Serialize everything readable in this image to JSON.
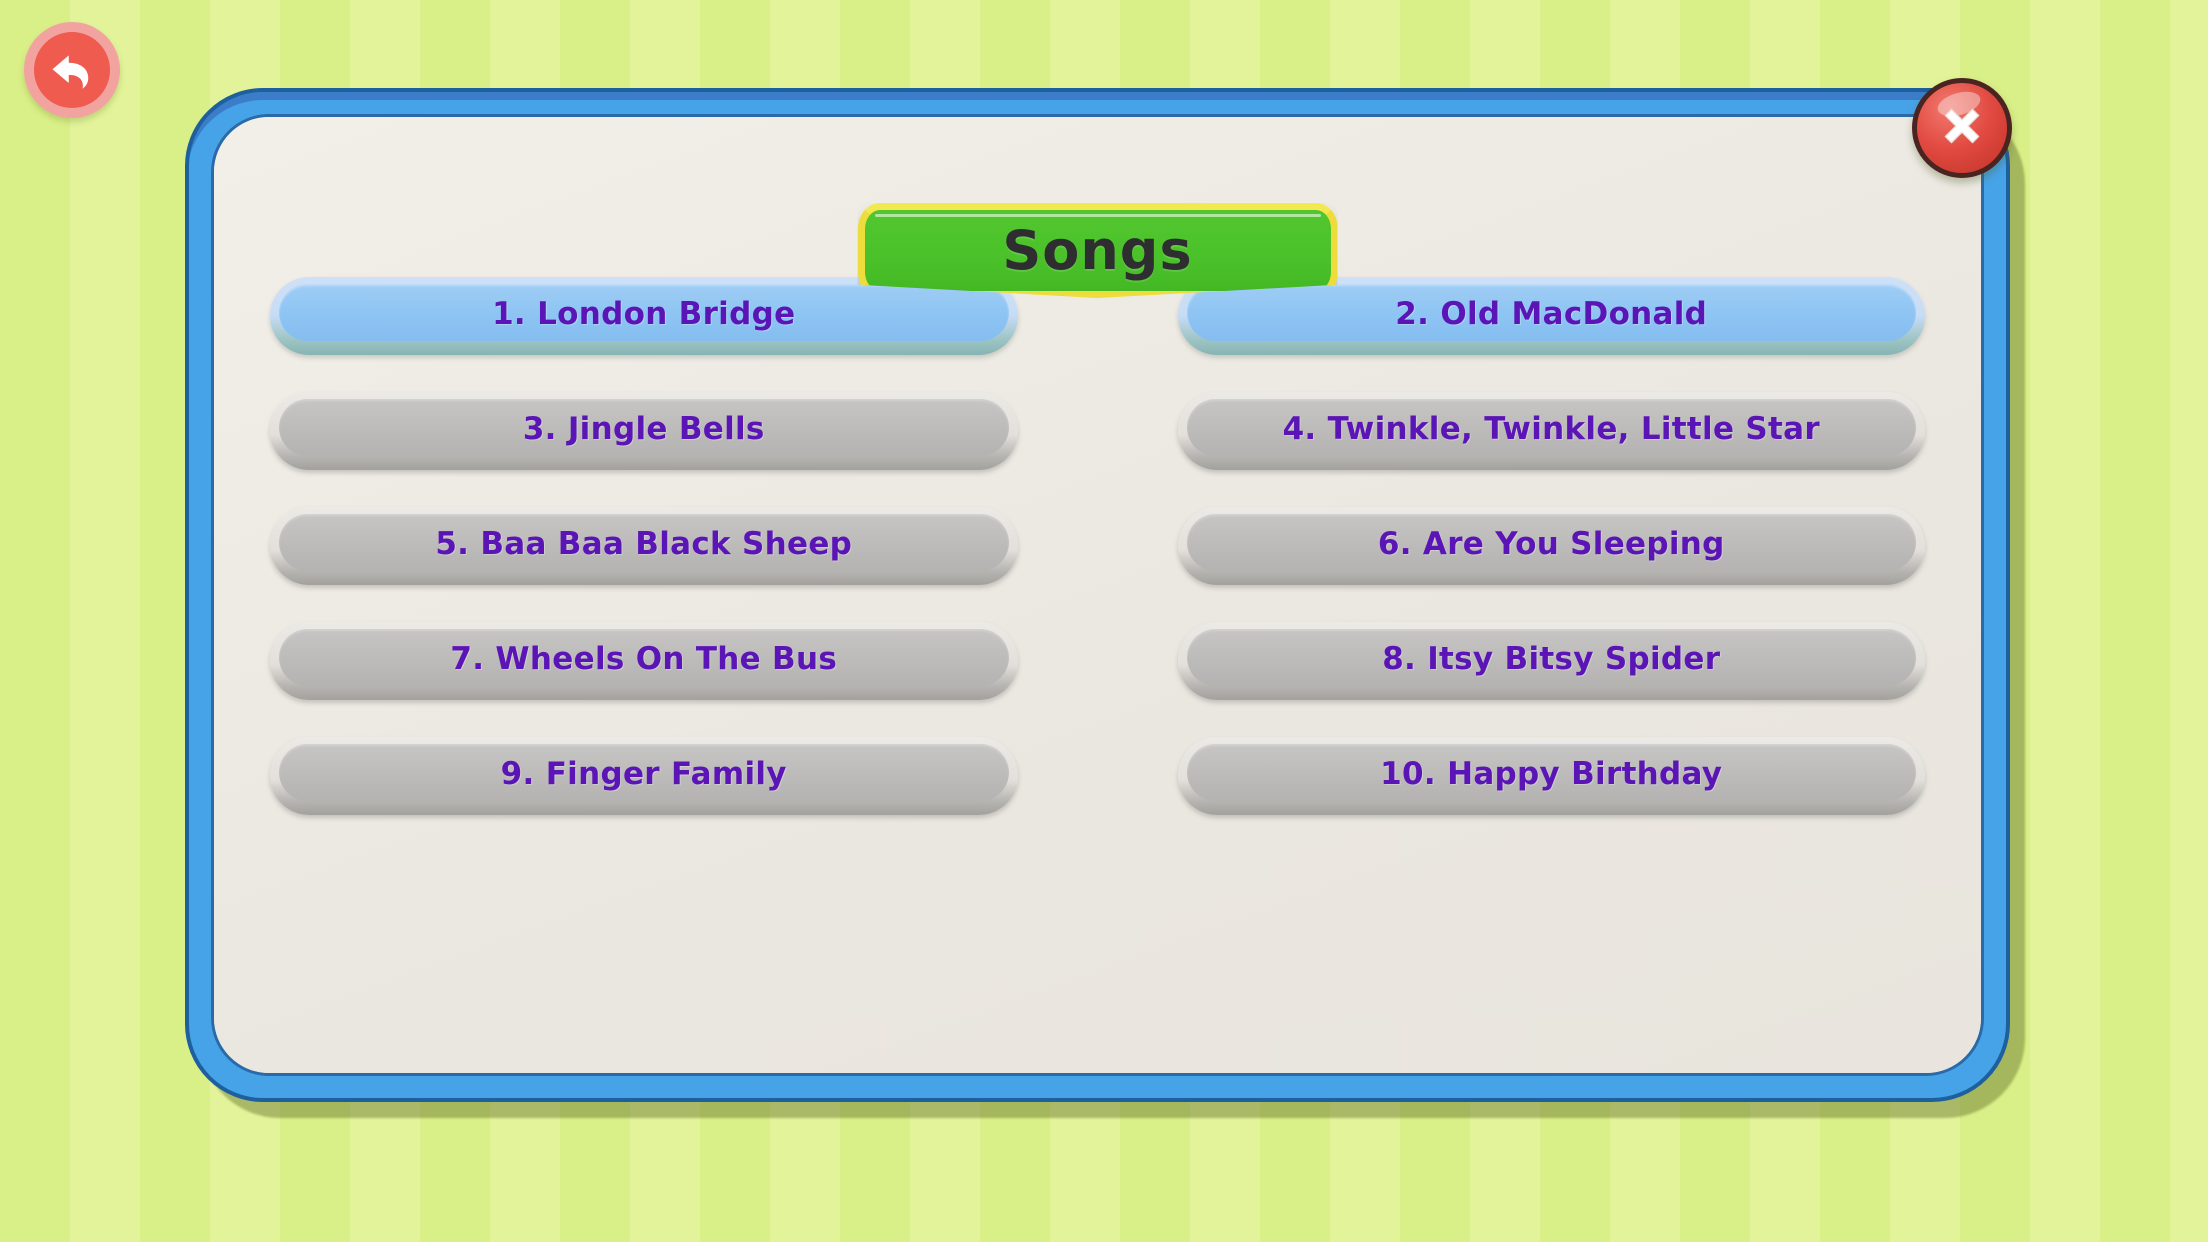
{
  "screen": {
    "title": "Songs",
    "background_color": "#d9ef87",
    "panel_border_color": "#46a3e8",
    "panel_fill_color": "#efece6"
  },
  "nav": {
    "back_button": {
      "label": "Back",
      "icon": "back-arrow-icon",
      "color": "#ef5b4e"
    },
    "close_button": {
      "label": "Close",
      "icon": "close-x-icon",
      "color": "#e14a40"
    }
  },
  "title_banner": {
    "text": "Songs",
    "fill_color": "#4bc22a",
    "border_color": "#ecdc3c",
    "text_color": "#2e2e30"
  },
  "song_list": {
    "text_color": "#5b14b5",
    "active_color": "#8dc4f3",
    "locked_color": "#bcbbba",
    "items": [
      {
        "number": "1.",
        "title": "London Bridge",
        "label": "1. London Bridge",
        "state": "active"
      },
      {
        "number": "2.",
        "title": "Old MacDonald",
        "label": "2. Old MacDonald",
        "state": "active"
      },
      {
        "number": "3.",
        "title": "Jingle Bells",
        "label": "3. Jingle Bells",
        "state": "locked"
      },
      {
        "number": "4.",
        "title": "Twinkle, Twinkle, Little Star",
        "label": "4. Twinkle, Twinkle, Little Star",
        "state": "locked"
      },
      {
        "number": "5.",
        "title": "Baa Baa Black Sheep",
        "label": "5. Baa Baa Black Sheep",
        "state": "locked"
      },
      {
        "number": "6.",
        "title": "Are You Sleeping",
        "label": "6. Are You Sleeping",
        "state": "locked"
      },
      {
        "number": "7.",
        "title": "Wheels On The Bus",
        "label": "7. Wheels On The Bus",
        "state": "locked"
      },
      {
        "number": "8.",
        "title": "Itsy Bitsy Spider",
        "label": "8. Itsy Bitsy Spider",
        "state": "locked"
      },
      {
        "number": "9.",
        "title": "Finger Family",
        "label": "9. Finger Family",
        "state": "locked"
      },
      {
        "number": "10.",
        "title": "Happy Birthday",
        "label": "10. Happy Birthday",
        "state": "locked"
      }
    ]
  }
}
